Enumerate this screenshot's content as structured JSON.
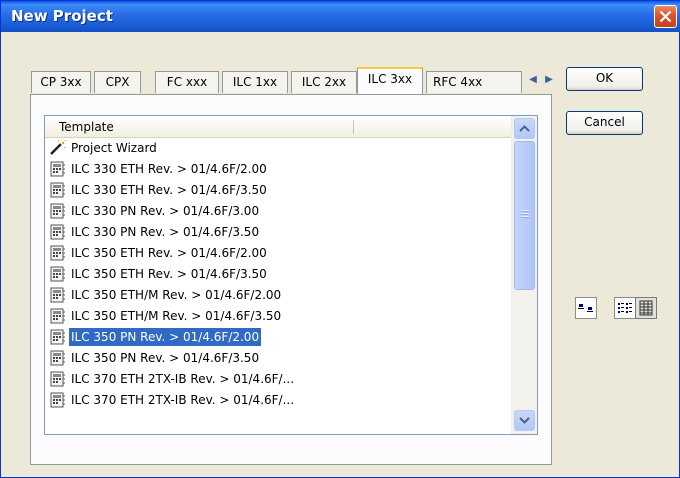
{
  "window": {
    "title": "New Project"
  },
  "tabs": [
    "CP 3xx",
    "CPX",
    "FC xxx",
    "ILC 1xx",
    "ILC 2xx",
    "ILC 3xx",
    "RFC 4xx"
  ],
  "active_tab": "ILC 3xx",
  "list": {
    "header": "Template",
    "items": [
      {
        "label": "Project Wizard",
        "icon": "wizard-icon"
      },
      {
        "label": "ILC 330 ETH Rev. > 01/4.6F/2.00",
        "icon": "controller-icon"
      },
      {
        "label": "ILC 330 ETH Rev. > 01/4.6F/3.50",
        "icon": "controller-icon"
      },
      {
        "label": "ILC 330 PN Rev. > 01/4.6F/3.00",
        "icon": "controller-icon"
      },
      {
        "label": "ILC 330 PN Rev. > 01/4.6F/3.50",
        "icon": "controller-icon"
      },
      {
        "label": "ILC 350 ETH Rev. > 01/4.6F/2.00",
        "icon": "controller-icon"
      },
      {
        "label": "ILC 350 ETH Rev. > 01/4.6F/3.50",
        "icon": "controller-icon"
      },
      {
        "label": "ILC 350 ETH/M Rev. > 01/4.6F/2.00",
        "icon": "controller-icon"
      },
      {
        "label": "ILC 350 ETH/M Rev. > 01/4.6F/3.50",
        "icon": "controller-icon"
      },
      {
        "label": "ILC 350 PN Rev. > 01/4.6F/2.00",
        "icon": "controller-icon",
        "selected": true
      },
      {
        "label": "ILC 350 PN Rev. > 01/4.6F/3.50",
        "icon": "controller-icon"
      },
      {
        "label": "ILC 370 ETH 2TX-IB Rev. > 01/4.6F/...",
        "icon": "controller-icon"
      },
      {
        "label": "ILC 370 ETH 2TX-IB Rev. > 01/4.6F/...",
        "icon": "controller-icon"
      }
    ]
  },
  "buttons": {
    "ok": "OK",
    "cancel": "Cancel"
  },
  "view_modes": [
    "large-icons-view-icon",
    "list-view-icon",
    "details-view-icon"
  ],
  "active_view": "details-view-icon",
  "colors": {
    "titlebar": "#2a6fe8",
    "selection": "#316ac5",
    "tab_highlight": "#ffc83c",
    "close": "#d9552a"
  }
}
